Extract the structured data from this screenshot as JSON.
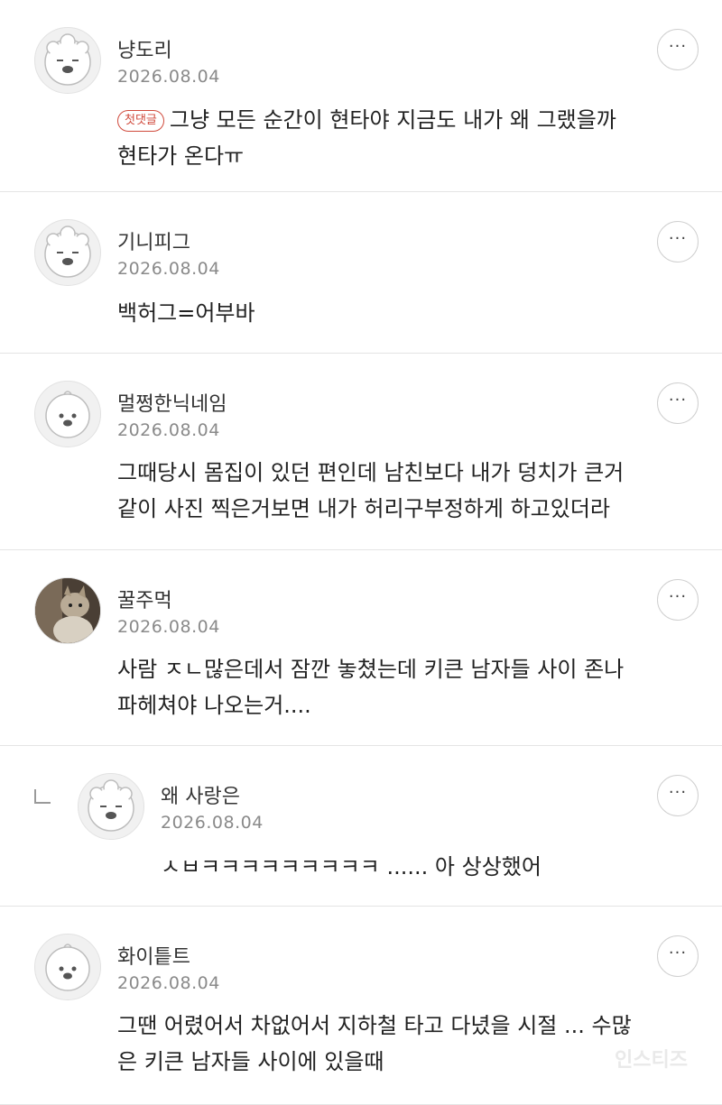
{
  "comments": [
    {
      "nickname": "냥도리",
      "date": "2026.08.04",
      "badge": "첫댓글",
      "lines": [
        "그냥 모든 순간이 현타야 지금도 내가 왜 그랬을까",
        "현타가 온다ㅠ"
      ],
      "avatar": "dog-avatar",
      "more_label": "···"
    },
    {
      "nickname": "기니피그",
      "date": "2026.08.04",
      "lines": [
        "백허그=어부바"
      ],
      "avatar": "dog-avatar",
      "more_label": "···"
    },
    {
      "nickname": "멀쩡한닉네임",
      "date": "2026.08.04",
      "lines": [
        "그때당시 몸집이 있던 편인데 남친보다 내가 덩치가 큰거",
        "같이 사진 찍은거보면 내가 허리구부정하게 하고있더라"
      ],
      "avatar": "chick-avatar",
      "more_label": "···"
    },
    {
      "nickname": "꿀주먹",
      "date": "2026.08.04",
      "lines": [
        "사람 ㅈㄴ많은데서 잠깐 놓쳤는데 키큰 남자들 사이 존나",
        "파헤쳐야 나오는거...."
      ],
      "avatar": "cat-photo-avatar",
      "more_label": "···"
    },
    {
      "nickname": "왜 사랑은",
      "date": "2026.08.04",
      "lines": [
        "ㅅㅂㅋㅋㅋㅋㅋㅋㅋㅋㅋ ...... 아 상상했어"
      ],
      "avatar": "dog-avatar",
      "reply": true,
      "more_label": "···"
    },
    {
      "nickname": "화이틑트",
      "date": "2026.08.04",
      "lines": [
        "그땐 어렸어서 차없어서 지하철 타고 다녔을 시절 ... 수많",
        "은 키큰 남자들 사이에 있을때"
      ],
      "avatar": "chick-avatar",
      "more_label": "···"
    }
  ],
  "watermark": "인스티즈"
}
